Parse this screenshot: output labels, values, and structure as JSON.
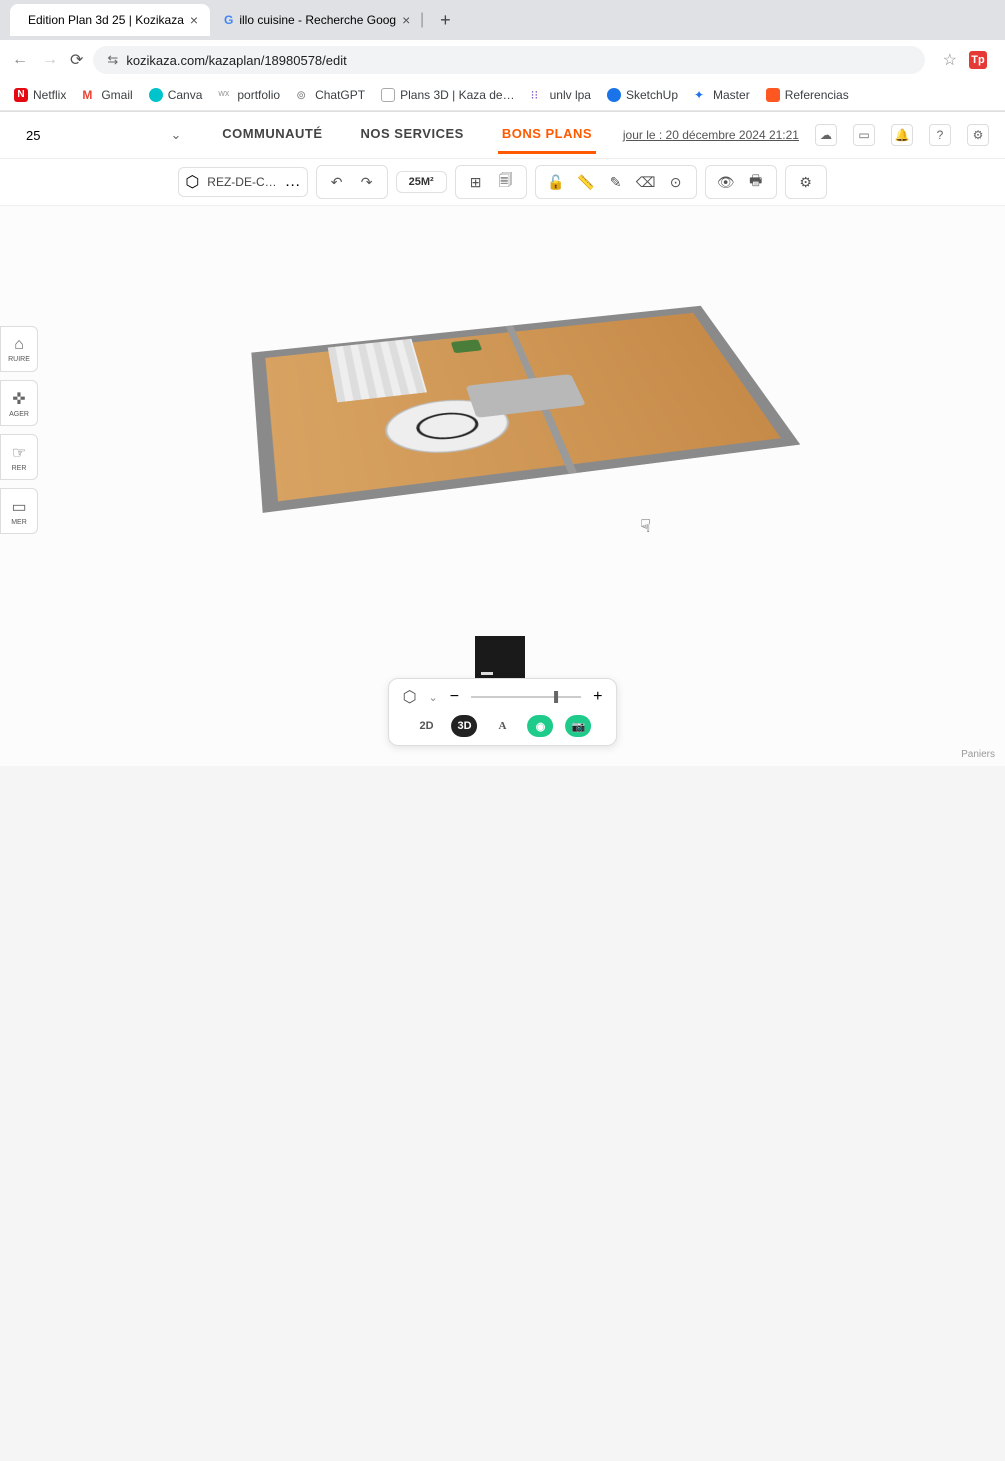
{
  "browser": {
    "tabs": [
      {
        "title": "Edition Plan 3d 25 | Kozikaza",
        "favicon": "#888"
      },
      {
        "title": "illo cuisine - Recherche Goog",
        "favicon_letter": "G"
      }
    ],
    "new_tab": "+",
    "url": "kozikaza.com/kazaplan/18980578/edit",
    "star_label": "☆",
    "ext_badge": "Tp"
  },
  "bookmarks": [
    {
      "label": "Netflix",
      "color": "#e50914",
      "glyph": "N"
    },
    {
      "label": "Gmail",
      "color": "#ea4335",
      "glyph": "M"
    },
    {
      "label": "Canva",
      "color": "#00c4cc",
      "glyph": "●"
    },
    {
      "label": "portfolio",
      "color": "#999",
      "glyph": "wx"
    },
    {
      "label": "ChatGPT",
      "color": "#888",
      "glyph": "⊚"
    },
    {
      "label": "Plans 3D | Kaza de…",
      "color": "#aaa",
      "glyph": "▢"
    },
    {
      "label": "unlv lpa",
      "color": "#7e57c2",
      "glyph": "⁝⁝"
    },
    {
      "label": "SketchUp",
      "color": "#1a73e8",
      "glyph": "●"
    },
    {
      "label": "Master",
      "color": "#1a73e8",
      "glyph": "✦"
    },
    {
      "label": "Referencias",
      "color": "#ff5722",
      "glyph": "▣"
    }
  ],
  "app": {
    "project_number": "25",
    "nav": {
      "communaute": "COMMUNAUTÉ",
      "services": "NOS SERVICES",
      "bonsplans": "BONS PLANS"
    },
    "timestamp": "jour le : 20 décembre 2024 21:21",
    "floor_label": "REZ-DE-C…",
    "area": "25M²"
  },
  "left_dock": [
    {
      "icon": "⌂",
      "label": "RUIRE"
    },
    {
      "icon": "✜",
      "label": "AGER"
    },
    {
      "icon": "☞",
      "label": "RER"
    },
    {
      "icon": "▭",
      "label": "MER"
    }
  ],
  "viewbar": {
    "mode2d": "2D",
    "mode3d": "3D",
    "zoom_minus": "−",
    "zoom_plus": "+"
  },
  "footer_note": "Paniers"
}
